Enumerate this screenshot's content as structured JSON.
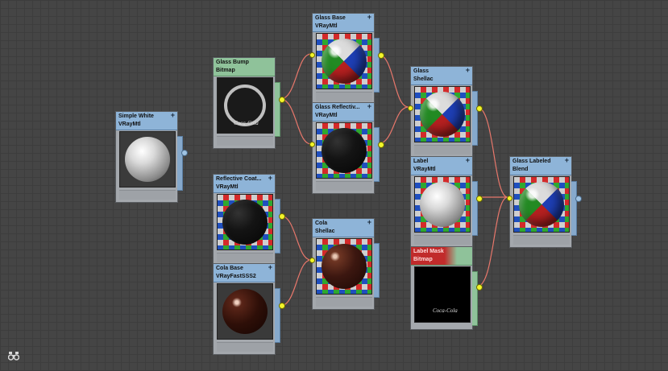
{
  "nodes": {
    "simple_white": {
      "title": "Simple White",
      "type": "VRayMtl"
    },
    "glass_bump": {
      "title": "Glass Bump",
      "type": "Bitmap"
    },
    "glass_base": {
      "title": "Glass Base",
      "type": "VRayMtl"
    },
    "glass_reflective": {
      "title": "Glass  Reflectiv...",
      "type": "VRayMtl"
    },
    "glass_shellac": {
      "title": "Glass",
      "type": "Shellac"
    },
    "reflective_coat": {
      "title": "Reflective  Coat...",
      "type": "VRayMtl"
    },
    "cola_base": {
      "title": "Cola Base",
      "type": "VRayFastSSS2"
    },
    "cola_shellac": {
      "title": "Cola",
      "type": "Shellac"
    },
    "label": {
      "title": "Label",
      "type": "VRayMtl"
    },
    "label_mask": {
      "title": "Label Mask",
      "type": "Bitmap"
    },
    "glass_labeled": {
      "title": "Glass Labeled",
      "type": "Blend"
    }
  },
  "plus_glyph": "+",
  "logo_text": "Coca-Cola",
  "icons": {
    "binoculars": "binoculars-icon"
  },
  "colors": {
    "material_header": "#8eb4d8",
    "map_header": "#8fc29a",
    "wire": "#e8776b",
    "port": "#f3f52a"
  }
}
